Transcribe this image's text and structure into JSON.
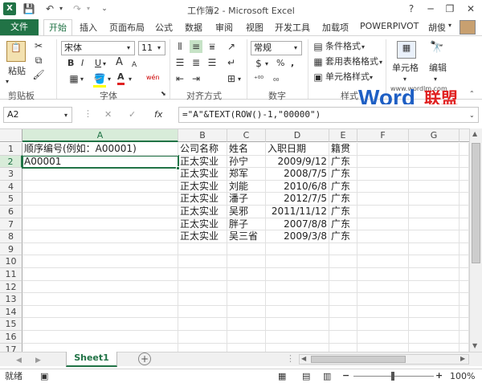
{
  "window": {
    "title": "工作簿2 - Microsoft Excel",
    "help": "?",
    "minimize": "─",
    "restore": "❐",
    "close": "✕"
  },
  "tabs": {
    "file": "文件",
    "items": [
      "开始",
      "插入",
      "页面布局",
      "公式",
      "数据",
      "审阅",
      "视图",
      "开发工具",
      "加载项",
      "POWERPIVOT"
    ],
    "user": "胡俊"
  },
  "ribbon": {
    "clipboard": {
      "paste": "粘贴",
      "label": "剪贴板"
    },
    "font": {
      "name": "宋体",
      "size": "11",
      "bold": "B",
      "italic": "I",
      "underline": "U",
      "grow": "A",
      "shrink": "A",
      "wen": "wén",
      "fill_color_glyph": "A",
      "label": "字体"
    },
    "alignment": {
      "label": "对齐方式"
    },
    "number": {
      "format": "常规",
      "percent": "%",
      "comma": ",",
      "label": "数字"
    },
    "styles": {
      "conditional": "条件格式",
      "table": "套用表格格式",
      "cell": "单元格样式",
      "label": "样式"
    },
    "cells": {
      "label": "单元格"
    },
    "editing": {
      "label": "编辑"
    },
    "watermark": {
      "url": "www.wordlm.com",
      "brand_en": "Word",
      "brand_cn": "联盟"
    }
  },
  "formula_bar": {
    "name_box": "A2",
    "fx": "fx",
    "formula": "=\"A\"&TEXT(ROW()-1,\"00000\")"
  },
  "grid": {
    "columns": [
      "A",
      "B",
      "C",
      "D",
      "E",
      "F",
      "G"
    ],
    "rows": [
      "1",
      "2",
      "3",
      "4",
      "5",
      "6",
      "7",
      "8",
      "9",
      "10",
      "11",
      "12",
      "13",
      "14",
      "15",
      "16",
      "17"
    ],
    "headers": [
      "顺序编号(例如：A00001)",
      "公司名称",
      "姓名",
      "入职日期",
      "籍贯"
    ],
    "a2": "A00001",
    "data": [
      [
        "正太实业",
        "孙宁",
        "2009/9/12",
        "广东"
      ],
      [
        "正太实业",
        "郑军",
        "2008/7/5",
        "广东"
      ],
      [
        "正太实业",
        "刘能",
        "2010/6/8",
        "广东"
      ],
      [
        "正太实业",
        "潘子",
        "2012/7/5",
        "广东"
      ],
      [
        "正太实业",
        "吴邪",
        "2011/11/12",
        "广东"
      ],
      [
        "正太实业",
        "胖子",
        "2007/8/8",
        "广东"
      ],
      [
        "正太实业",
        "吴三省",
        "2009/3/8",
        "广东"
      ]
    ]
  },
  "sheet": {
    "tab": "Sheet1",
    "add": "+"
  },
  "status": {
    "left": "就绪",
    "zoom": "100%"
  },
  "colors": {
    "accent": "#217346",
    "brand_blue": "#1e5fc4",
    "brand_red": "#e02020"
  }
}
